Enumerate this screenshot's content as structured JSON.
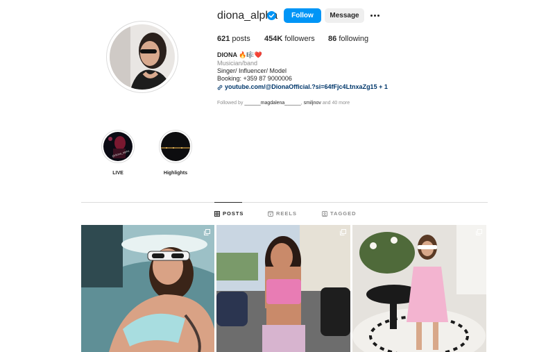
{
  "profile": {
    "username": "diona_alpha",
    "follow_label": "Follow",
    "message_label": "Message",
    "stats": {
      "posts_count": "621",
      "posts_label": "posts",
      "followers_count": "454K",
      "followers_label": "followers",
      "following_count": "86",
      "following_label": "following"
    },
    "bio": {
      "name": "DIONA 🔥🎼❤️",
      "category": "Musician/band",
      "line1": "Singer/ Influencer/ Model",
      "line2": "Booking: +359 87 9000006",
      "link": "youtube.com/@DionaOfficial.?si=64fFjc4LtnxaZg15 + 1",
      "followed_prefix": "Followed by",
      "followed_user1": "______magdalena______",
      "followed_sep": ",",
      "followed_user2": "smiljnov",
      "followed_suffix": "and 40 more"
    }
  },
  "highlights": [
    {
      "label": "LIVE"
    },
    {
      "label": "Highlights"
    }
  ],
  "tabs": [
    {
      "label": "POSTS",
      "active": true
    },
    {
      "label": "REELS",
      "active": false
    },
    {
      "label": "TAGGED",
      "active": false
    }
  ],
  "posts": [
    {
      "icon": "multiple-images-icon"
    },
    {
      "icon": "multiple-images-icon"
    },
    {
      "icon": "multiple-images-icon"
    }
  ],
  "colors": {
    "accent": "#0095f6",
    "verified": "#0095f6",
    "link": "#00376b",
    "secondary_text": "#8e8e8e"
  }
}
